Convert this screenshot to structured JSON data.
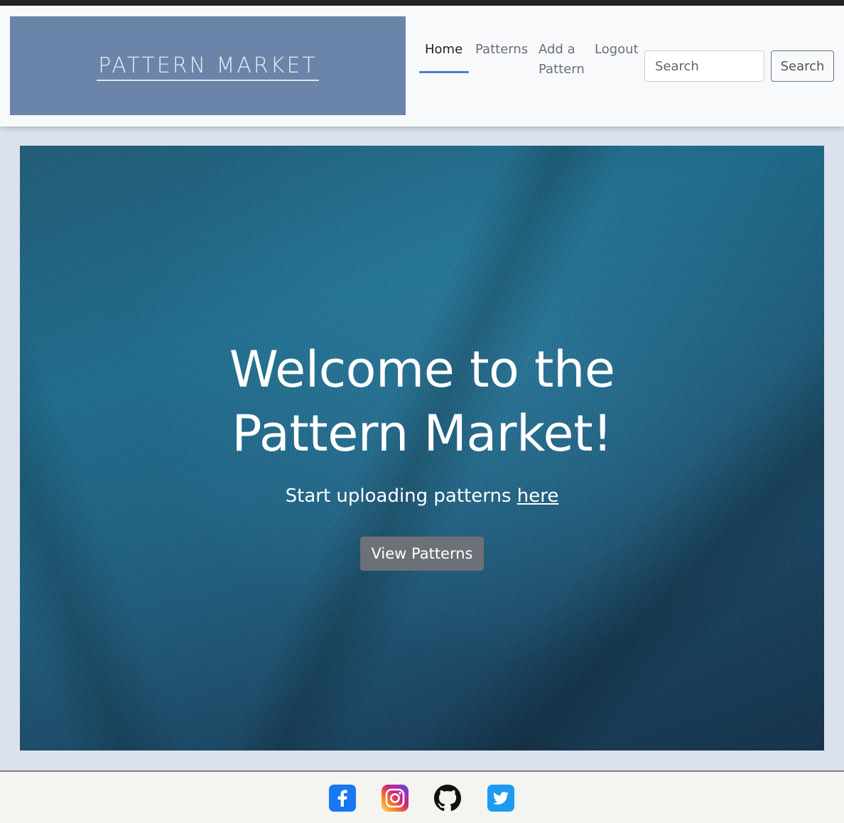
{
  "nav": {
    "logo_text": "PATTERN MARKET",
    "links": [
      {
        "label": "Home"
      },
      {
        "label": "Patterns"
      },
      {
        "label": "Add a\nPattern"
      },
      {
        "label": "Logout"
      }
    ],
    "search_placeholder": "Search",
    "search_button": "Search"
  },
  "hero": {
    "title": "Welcome to the Pattern Market!",
    "subtitle_prefix": "Start uploading patterns ",
    "subtitle_link": "here",
    "button": "View Patterns"
  },
  "footer": {
    "icons": [
      "facebook-icon",
      "instagram-icon",
      "github-icon",
      "twitter-icon"
    ]
  },
  "colors": {
    "accent": "#4c7fd0",
    "logo_bg": "#6b84a9",
    "button_bg": "#6c7177"
  }
}
